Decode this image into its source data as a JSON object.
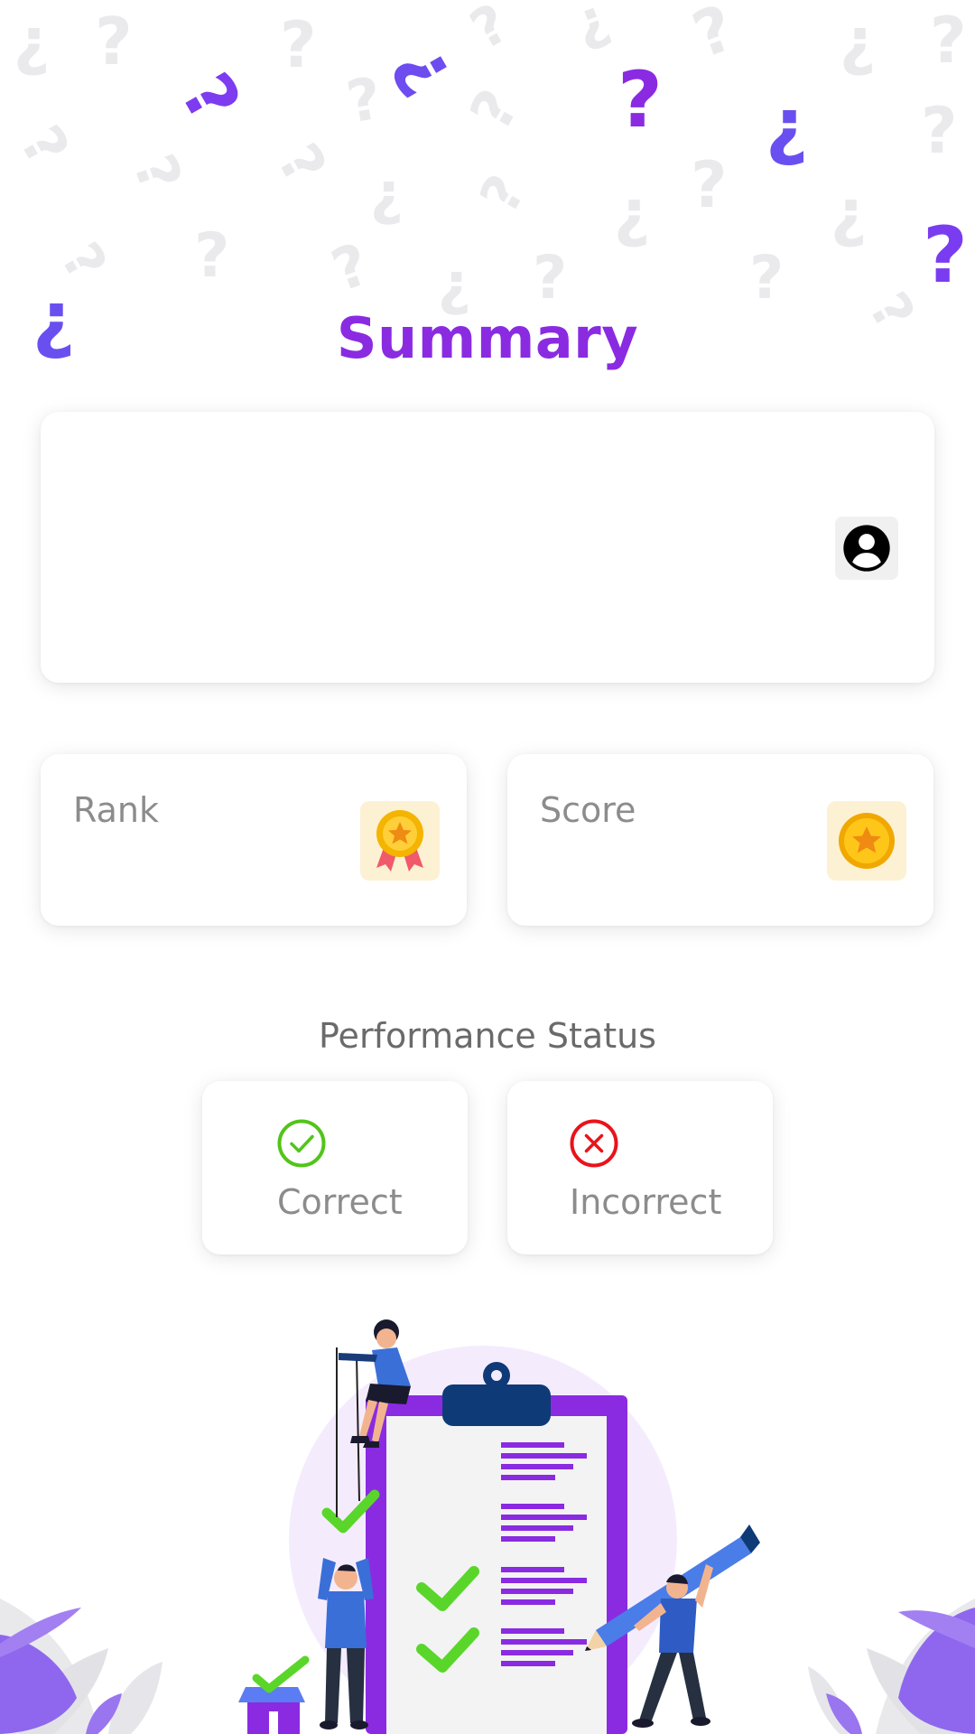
{
  "header": {
    "title": "Summary"
  },
  "profile_card": {
    "avatar_icon": "account-circle-icon"
  },
  "stats": {
    "rank": {
      "label": "Rank",
      "icon": "medal-icon"
    },
    "score": {
      "label": "Score",
      "icon": "coin-icon"
    }
  },
  "performance": {
    "title": "Performance Status",
    "correct": {
      "label": "Correct",
      "icon": "check-circle-icon",
      "color": "#52c41a"
    },
    "incorrect": {
      "label": "Incorrect",
      "icon": "close-circle-icon",
      "color": "#e8141b"
    }
  },
  "colors": {
    "accent": "#8a2be2",
    "accent_blue": "#4a6cf7",
    "card_bg": "#ffffff",
    "muted_text": "#8c8c8c"
  }
}
